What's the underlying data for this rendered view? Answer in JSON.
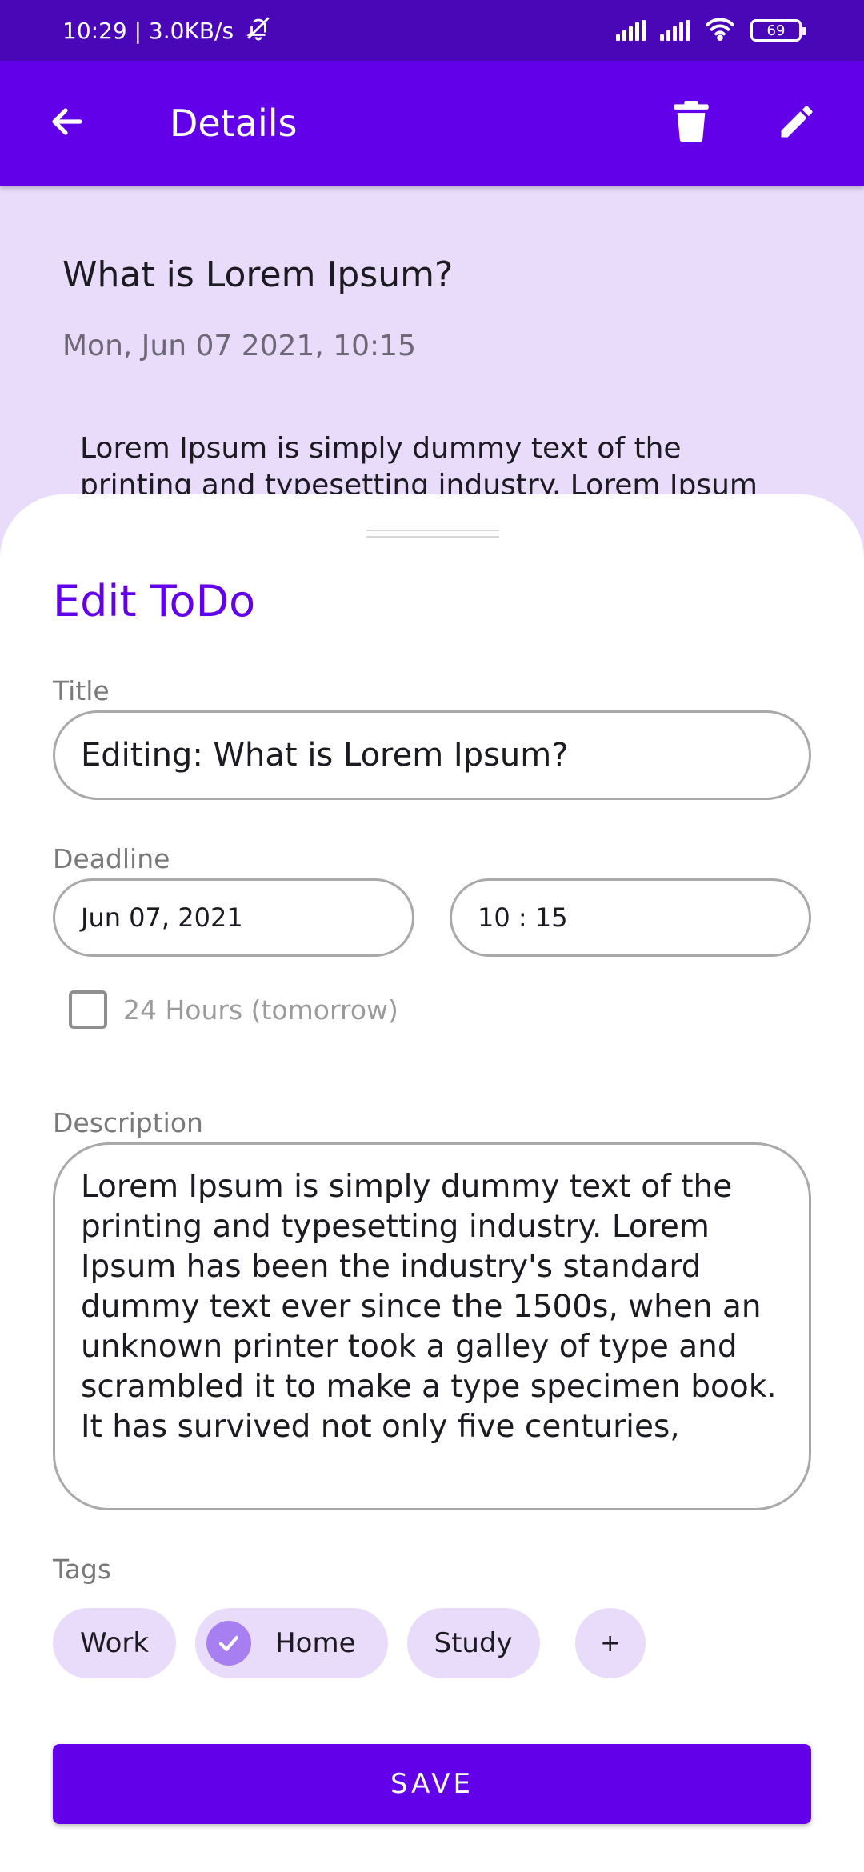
{
  "status_bar": {
    "time_speed": "10:29 | 3.0KB/s",
    "battery": "69",
    "mute_icon": "bell-off-icon",
    "signal_icon": "signal-icon",
    "wifi_icon": "wifi-icon"
  },
  "app_bar": {
    "title": "Details",
    "back_icon": "arrow-back-icon",
    "delete_icon": "trash-icon",
    "edit_icon": "pencil-icon"
  },
  "details": {
    "title": "What is Lorem Ipsum?",
    "date": "Mon, Jun 07 2021, 10:15",
    "body": "Lorem Ipsum is simply dummy text of the printing and typesetting industry. Lorem Ipsum"
  },
  "sheet": {
    "title": "Edit ToDo",
    "title_label": "Title",
    "title_value": "Editing: What is Lorem Ipsum?",
    "deadline_label": "Deadline",
    "date_value": "Jun 07, 2021",
    "time_value": "10 : 15",
    "checkbox_label": "24 Hours (tomorrow)",
    "description_label": "Description",
    "description_value": "Lorem Ipsum is simply dummy text of the printing and typesetting industry. Lorem Ipsum has been the industry's standard dummy text ever since the 1500s, when an unknown printer took a galley of type and scrambled it to make a type specimen book. It has survived not only five centuries,",
    "tags_label": "Tags",
    "tags": [
      {
        "label": "Work",
        "selected": false
      },
      {
        "label": "Home",
        "selected": true
      },
      {
        "label": "Study",
        "selected": false
      }
    ],
    "add_tag_label": "+",
    "save_label": "SAVE"
  },
  "colors": {
    "primary": "#6200ea",
    "status_bar": "#4a07b8",
    "background": "#e9dcfb",
    "chip": "#e9dcfb",
    "chip_check": "#a77ff0"
  }
}
